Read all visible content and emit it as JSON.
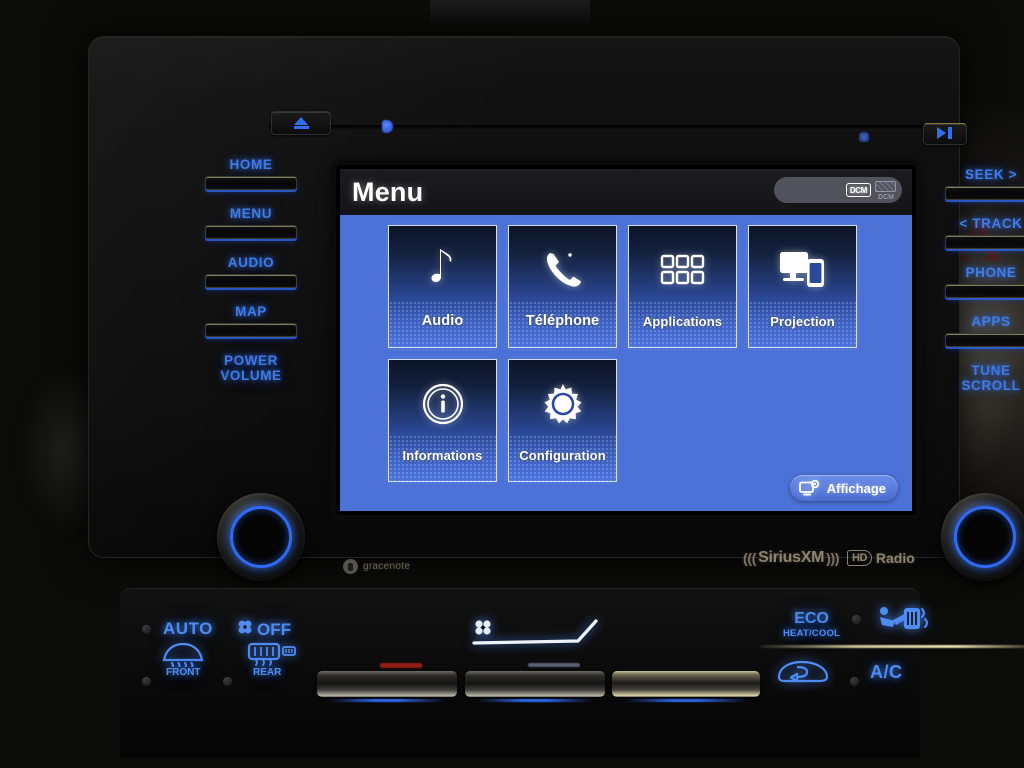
{
  "screen": {
    "title": "Menu",
    "status": {
      "dcm_label": "DCM",
      "dcm_secondary_label": "DCM"
    },
    "tiles": [
      {
        "id": "audio",
        "label": "Audio",
        "icon": "music-note-icon"
      },
      {
        "id": "telephone",
        "label": "Téléphone",
        "icon": "phone-handset-icon"
      },
      {
        "id": "applications",
        "label": "Applications",
        "icon": "app-grid-icon"
      },
      {
        "id": "projection",
        "label": "Projection",
        "icon": "screen-mirroring-icon"
      },
      {
        "id": "informations",
        "label": "Informations",
        "icon": "info-circle-icon"
      },
      {
        "id": "configuration",
        "label": "Configuration",
        "icon": "gear-icon"
      }
    ],
    "display_button": {
      "label": "Affichage",
      "icon": "display-settings-icon"
    },
    "colors": {
      "background_blue": "#4c72d7",
      "tile_border": "#d4ddf4",
      "titlebar": "#1b1b20",
      "button_blue": "#5d81e2"
    }
  },
  "hardware": {
    "left_buttons": [
      {
        "label": "HOME"
      },
      {
        "label": "MENU"
      },
      {
        "label": "AUDIO"
      },
      {
        "label": "MAP"
      }
    ],
    "left_knob_label_line1": "POWER",
    "left_knob_label_line2": "VOLUME",
    "right_buttons": [
      {
        "label": "SEEK >"
      },
      {
        "label": "< TRACK"
      },
      {
        "label": "PHONE"
      },
      {
        "label": "APPS"
      }
    ],
    "right_knob_label_line1": "TUNE",
    "right_knob_label_line2": "SCROLL",
    "eject_icon": "eject-icon",
    "play_pause_icon": "play-pause-icon",
    "led_color": "#2f6ff5"
  },
  "branding": {
    "gracenote": "gracenote",
    "siriusxm": "SiriusXM",
    "siriusxm_left_waves": "(((",
    "siriusxm_right_waves": ")))",
    "hd_mark": "HD",
    "hd_radio": "Radio"
  },
  "climate": {
    "auto_label": "AUTO",
    "fan_off_label": "OFF",
    "eco_label": "ECO",
    "eco_sub_label": "HEAT/COOL",
    "ac_label": "A/C",
    "front_defrost_label": "FRONT",
    "rear_defrost_label": "REAR",
    "icons": {
      "fan": "fan-icon",
      "front_defrost": "front-defrost-icon",
      "rear_defrost": "rear-defrost-icon",
      "seat_airflow": "seat-airflow-icon",
      "recirculation": "air-recirculation-icon",
      "fan_speed_indicator": "fan-speed-ramp-icon"
    },
    "accent_color": "#4f8cf2"
  }
}
